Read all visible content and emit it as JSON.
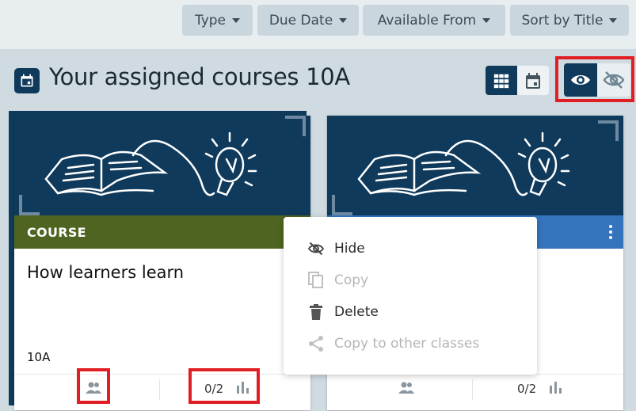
{
  "filters": [
    {
      "label": "Type"
    },
    {
      "label": "Due Date"
    },
    {
      "label": "Available From"
    },
    {
      "label": "Sort by Title"
    }
  ],
  "header": {
    "title": "Your assigned courses",
    "class_name": "10A",
    "title_icon": "calendar-icon"
  },
  "view_toggle": {
    "grid_icon": "grid-view-icon",
    "calendar_icon": "calendar-view-icon",
    "active": "grid"
  },
  "visibility_toggle": {
    "show_icon": "eye-icon",
    "hide_icon": "eye-off-icon",
    "active": "show"
  },
  "cards": [
    {
      "type_label": "COURSE",
      "type_color": "#4e6420",
      "title": "How learners learn",
      "class": "10A",
      "score": "0/2",
      "icons": [
        "people-icon",
        "bar-chart-icon"
      ]
    },
    {
      "type_label": "",
      "type_color": "#3474bd",
      "title": "",
      "class": "",
      "score": "0/2",
      "icons": [
        "people-icon",
        "bar-chart-icon",
        "more-vertical-icon"
      ]
    }
  ],
  "context_menu": {
    "items": [
      {
        "label": "Hide",
        "icon": "eye-off-icon",
        "enabled": true
      },
      {
        "label": "Copy",
        "icon": "copy-icon",
        "enabled": false
      },
      {
        "label": "Delete",
        "icon": "trash-icon",
        "enabled": true
      },
      {
        "label": "Copy to other classes",
        "icon": "share-icon",
        "enabled": false
      }
    ]
  },
  "colors": {
    "primary": "#0f3a5c",
    "highlight": "#e01e24",
    "course": "#4e6420",
    "other": "#3474bd"
  }
}
